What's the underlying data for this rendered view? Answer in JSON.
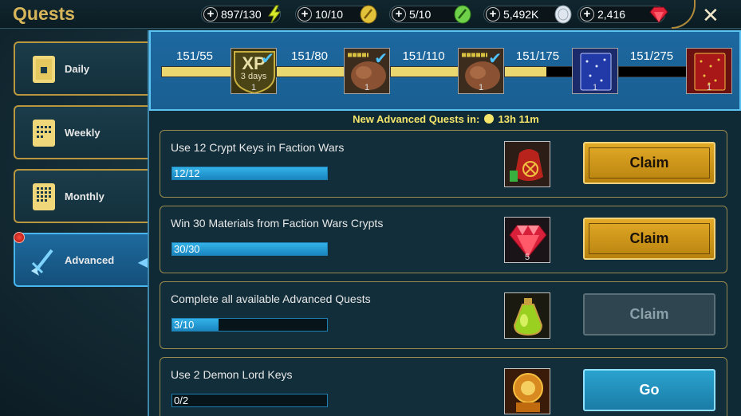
{
  "title": "Quests",
  "resources": [
    {
      "value": "897/130",
      "icon": "energy-icon"
    },
    {
      "value": "10/10",
      "icon": "gold-key-icon"
    },
    {
      "value": "5/10",
      "icon": "green-key-icon"
    },
    {
      "value": "5,492K",
      "icon": "silver-icon"
    },
    {
      "value": "2,416",
      "icon": "gem-icon"
    }
  ],
  "tabs": [
    {
      "label": "Daily"
    },
    {
      "label": "Weekly"
    },
    {
      "label": "Monthly"
    },
    {
      "label": "Advanced"
    }
  ],
  "milestones": [
    {
      "progress": "151/55",
      "fill": 1.0,
      "reward_label": "XP",
      "reward_sub": "3 days",
      "count": "1",
      "claimed": true
    },
    {
      "progress": "151/80",
      "fill": 1.0,
      "reward_label": "",
      "reward_sub": "",
      "count": "1",
      "claimed": true
    },
    {
      "progress": "151/110",
      "fill": 1.0,
      "reward_label": "",
      "reward_sub": "",
      "count": "1",
      "claimed": true
    },
    {
      "progress": "151/175",
      "fill": 0.62,
      "reward_label": "",
      "reward_sub": "",
      "count": "1",
      "claimed": false
    },
    {
      "progress": "151/275",
      "fill": 0.0,
      "reward_label": "",
      "reward_sub": "",
      "count": "1",
      "claimed": false
    }
  ],
  "timer": {
    "label": "New Advanced Quests in:",
    "value": "13h 11m"
  },
  "quests": [
    {
      "text": "Use 12 Crypt Keys in Faction Wars",
      "progress": "12/12",
      "fill": 1.0,
      "reward_count": "",
      "button": "Claim",
      "state": "claim"
    },
    {
      "text": "Win 30 Materials from Faction Wars Crypts",
      "progress": "30/30",
      "fill": 1.0,
      "reward_count": "5",
      "button": "Claim",
      "state": "claim"
    },
    {
      "text": "Complete all available Advanced Quests",
      "progress": "3/10",
      "fill": 0.3,
      "reward_count": "",
      "button": "Claim",
      "state": "disabled"
    },
    {
      "text": "Use 2 Demon Lord Keys",
      "progress": "0/2",
      "fill": 0.0,
      "reward_count": "",
      "button": "Go",
      "state": "go"
    }
  ],
  "colors": {
    "gold": "#d7b55a",
    "active_tab": "#1e6a9e",
    "claim": "#e3aa27",
    "go": "#2aa3cf"
  }
}
